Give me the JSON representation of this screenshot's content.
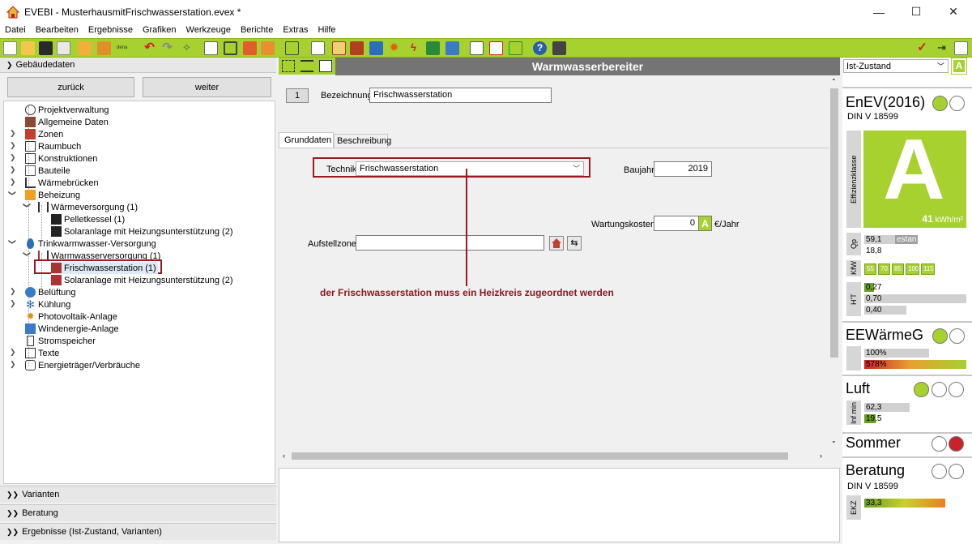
{
  "window": {
    "title": "EVEBI - MusterhausmitFrischwasserstation.evex *",
    "minimize": "—",
    "maximize": "☐",
    "close": "✕"
  },
  "menu": [
    "Datei",
    "Bearbeiten",
    "Ergebnisse",
    "Grafiken",
    "Werkzeuge",
    "Berichte",
    "Extras",
    "Hilfe"
  ],
  "left": {
    "header": "Gebäudedaten",
    "back": "zurück",
    "next": "weiter",
    "tree": [
      {
        "label": "Projektverwaltung"
      },
      {
        "label": "Allgemeine Daten"
      },
      {
        "label": "Zonen"
      },
      {
        "label": "Raumbuch"
      },
      {
        "label": "Konstruktionen"
      },
      {
        "label": "Bauteile"
      },
      {
        "label": "Wärmebrücken"
      },
      {
        "label": "Beheizung"
      },
      {
        "label": "Wärmeversorgung (1)"
      },
      {
        "label": "Pelletkessel (1)"
      },
      {
        "label": "Solaranlage mit Heizungsunterstützung (2)"
      },
      {
        "label": "Trinkwarmwasser-Versorgung"
      },
      {
        "label": "Warmwasserversorgung (1)"
      },
      {
        "label": "Frischwasserstation (1)"
      },
      {
        "label": "Solaranlage mit Heizungsunterstützung (2)"
      },
      {
        "label": "Belüftung"
      },
      {
        "label": "Kühlung"
      },
      {
        "label": "Photovoltaik-Anlage"
      },
      {
        "label": "Windenergie-Anlage"
      },
      {
        "label": "Stromspeicher"
      },
      {
        "label": "Texte"
      },
      {
        "label": "Energieträger/Verbräuche"
      }
    ],
    "sections": [
      "Varianten",
      "Beratung",
      "Ergebnisse (Ist-Zustand, Varianten)"
    ]
  },
  "center": {
    "header": "Warmwasserbereiter",
    "number": "1",
    "bezeichnung_label": "Bezeichnung",
    "bezeichnung_value": "Frischwasserstation",
    "tabs": [
      "Grunddaten",
      "Beschreibung"
    ],
    "technik_label": "Technik",
    "technik_value": "Frischwasserstation",
    "baujahr_label": "Baujahr",
    "baujahr_value": "2019",
    "wartung_label": "Wartungskosten",
    "wartung_value": "0",
    "wartung_badge": "A",
    "wartung_unit": "€/Jahr",
    "aufstellzone_label": "Aufstellzone",
    "aufstellzone_value": "",
    "annotation": "der Frischwasserstation muss ein Heizkreis zugeordnet werden"
  },
  "right": {
    "state_select": "Ist-Zustand",
    "state_badge": "A",
    "enev_title": "EnEV(2016)",
    "enev_sub": "DIN V 18599",
    "effizienz_label": "Effizienzklasse",
    "effizienz_class": "A",
    "effizienz_value": "41",
    "effizienz_unit": "kWh/m²",
    "qp_label": "Qp",
    "qp_values": [
      "59,1",
      "18,8"
    ],
    "qp_estan": "estan",
    "kw_label": "KfW",
    "kw_values": [
      "55",
      "70",
      "85",
      "100",
      "115"
    ],
    "ht_label": "H'T",
    "ht_values": [
      "0,27",
      "0,70",
      "0,40"
    ],
    "eew_title": "EEWärmeG",
    "eew_values": [
      "100%",
      "578%"
    ],
    "luft_title": "Luft",
    "luft_label": "Inf min",
    "luft_values": [
      "62,3",
      "19,5"
    ],
    "sommer_title": "Sommer",
    "beratung_title": "Beratung",
    "beratung_sub": "DIN V 18599",
    "ekz_label": "EKZ",
    "ekz_value": "33,3",
    "colors": {
      "accent": "#a6d12f",
      "red": "#c8232c",
      "header": "#747474"
    }
  }
}
